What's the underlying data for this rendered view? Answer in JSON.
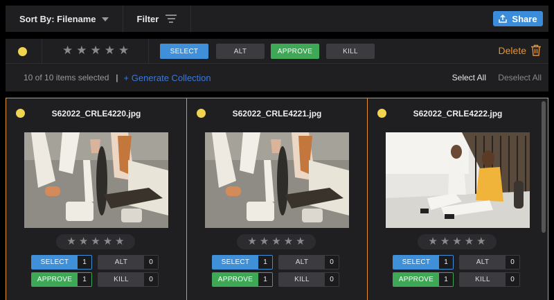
{
  "toolbar": {
    "sort_label": "Sort By: Filename",
    "filter_label": "Filter",
    "share_label": "Share"
  },
  "actionbar": {
    "rating_stars": [
      "★",
      "★",
      "★",
      "★",
      "★"
    ],
    "tags": {
      "select": "SELECT",
      "alt": "ALT",
      "approve": "APPROVE",
      "kill": "KILL"
    },
    "delete_label": "Delete",
    "selection_count": "10 of 10 items selected",
    "separator": "|",
    "generate_collection": "+ Generate Collection",
    "select_all": "Select All",
    "deselect_all": "Deselect All"
  },
  "cards": [
    {
      "filename": "S62022_CRLE4220.jpg",
      "select": "SELECT",
      "select_count": "1",
      "alt": "ALT",
      "alt_count": "0",
      "approve": "APPROVE",
      "approve_count": "1",
      "kill": "KILL",
      "kill_count": "0"
    },
    {
      "filename": "S62022_CRLE4221.jpg",
      "select": "SELECT",
      "select_count": "1",
      "alt": "ALT",
      "alt_count": "0",
      "approve": "APPROVE",
      "approve_count": "1",
      "kill": "KILL",
      "kill_count": "0"
    },
    {
      "filename": "S62022_CRLE4222.jpg",
      "select": "SELECT",
      "select_count": "1",
      "alt": "ALT",
      "alt_count": "0",
      "approve": "APPROVE",
      "approve_count": "1",
      "kill": "KILL",
      "kill_count": "0"
    }
  ],
  "colors": {
    "accent_blue": "#3f8fd9",
    "approve_green": "#3fa857",
    "delete_orange": "#e8932d",
    "status_yellow": "#f1d44f",
    "panel_bg": "#1f1f22"
  }
}
